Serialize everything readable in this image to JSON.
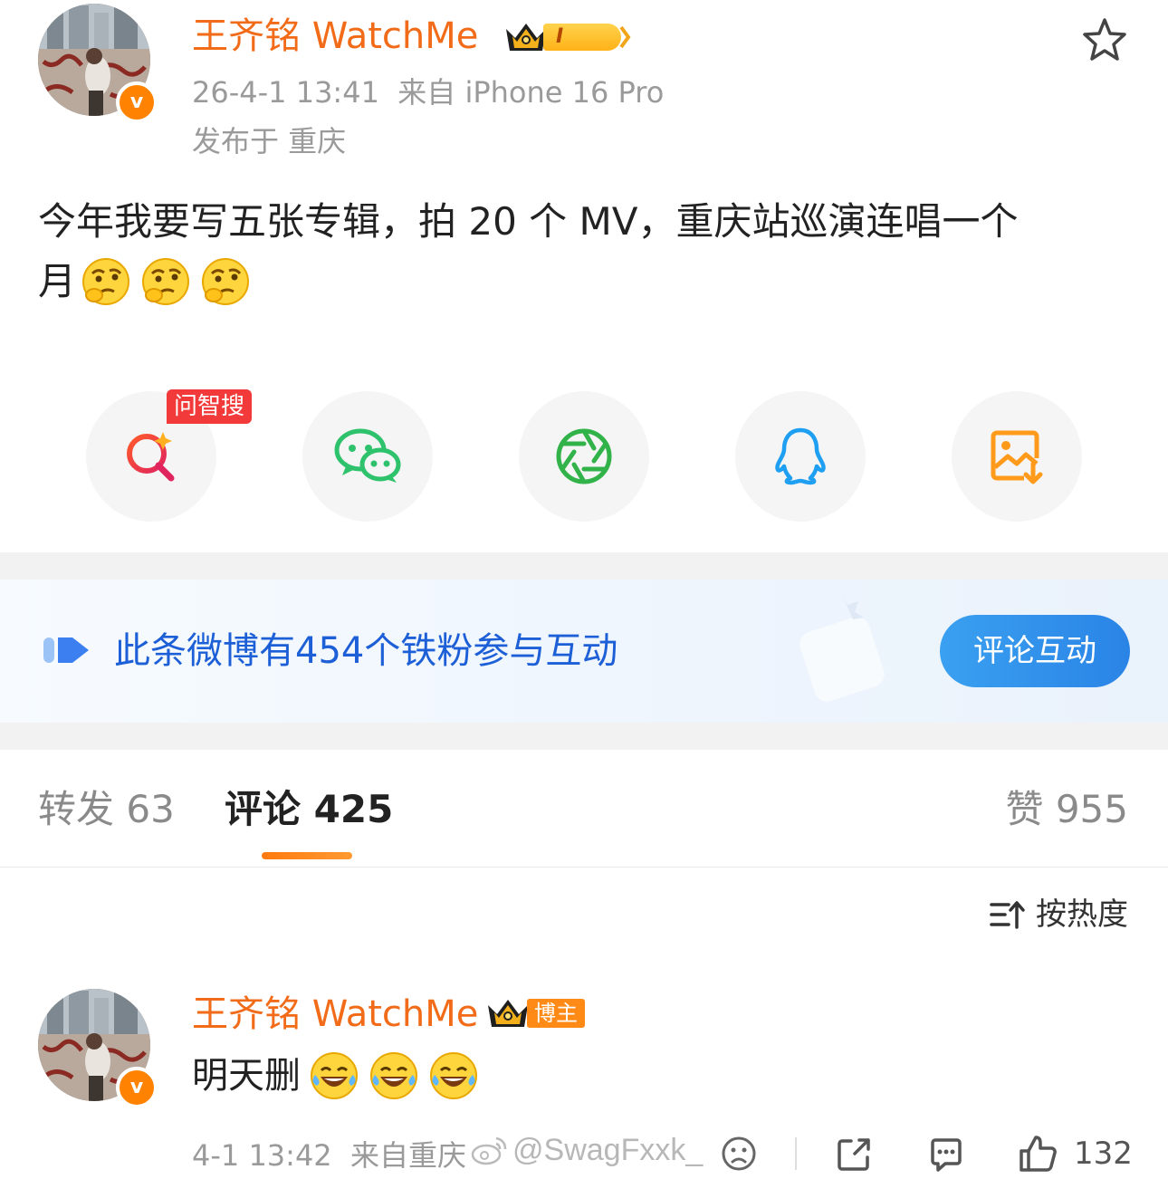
{
  "post": {
    "author": "王齐铭 WatchMe",
    "level_tag": "I",
    "timestamp": "26-4-1 13:41",
    "source": "来自 iPhone 16 Pro",
    "location": "发布于 重庆",
    "text_line1": "今年我要写五张专辑，拍 20 个 MV，重庆站巡演连唱一个",
    "text_line2": "月",
    "emojis": [
      "thinking-emoji",
      "thinking-emoji",
      "thinking-emoji"
    ]
  },
  "share": {
    "items": [
      "wenzhisou",
      "wechat",
      "moments",
      "qq",
      "save-image"
    ],
    "wenzhisou_tag": "问智搜"
  },
  "fan_banner": {
    "text": "此条微博有454个铁粉参与互动",
    "button": "评论互动"
  },
  "tabs": {
    "repost": "转发 63",
    "comments": "评论 425",
    "likes": "赞 955"
  },
  "sort": {
    "label": "按热度"
  },
  "comment": {
    "author": "王齐铭 WatchMe",
    "role_tag": "博主",
    "text": "明天删",
    "emojis": [
      "laugh-cry-emoji",
      "laugh-cry-emoji",
      "laugh-cry-emoji"
    ],
    "timestamp": "4-1 13:42",
    "source": "来自重庆",
    "watermark": "@SwagFxxk_",
    "like_count": "132"
  },
  "colors": {
    "accent_orange": "#f26b18",
    "link_blue": "#1d5fd6",
    "button_blue": "#2a84e6",
    "wenzhisou_red": "#f23a3a"
  }
}
